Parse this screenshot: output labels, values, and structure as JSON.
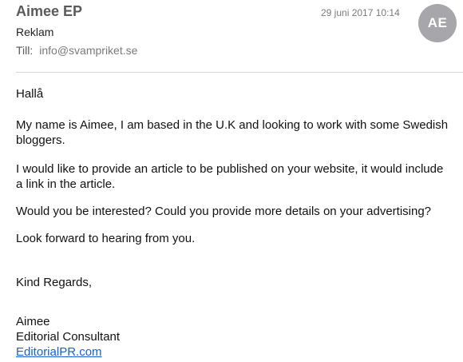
{
  "header": {
    "sender_name": "Aimee EP",
    "date": "29 juni 2017 10:14",
    "avatar_initials": "AE",
    "subject": "Reklam",
    "to_label": "Till:",
    "to_value": "info@svampriket.se"
  },
  "body": {
    "greeting": "Hallå",
    "paragraphs": [
      "My name is Aimee, I am based in the U.K and looking to work with some Swedish bloggers.",
      "I would like to provide an article to be published on your website, it would include a link in the article.",
      "Would you be interested? Could you provide more details on your advertising?",
      "Look forward to hearing from you."
    ],
    "closing": "Kind Regards,",
    "signature": {
      "name": "Aimee",
      "title": "Editorial Consultant",
      "link": "EditorialPR.com"
    }
  },
  "colors": {
    "avatar_bg": "#a6a6ab",
    "link": "#1a5fd0",
    "divider": "#d6d6d6"
  }
}
